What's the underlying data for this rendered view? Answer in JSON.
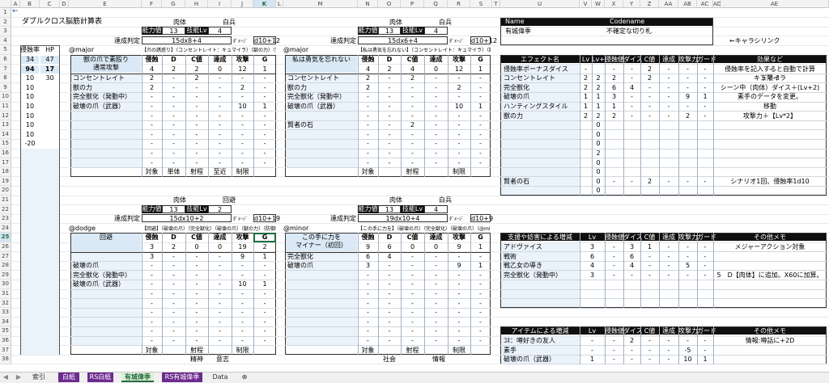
{
  "colors": {
    "tab_purple": "#6d2b8f",
    "tab_green": "#dff0d8",
    "selection_green": "#1e6b3c",
    "header_blue": "#dbe9f6",
    "dark_header": "#0f0f0f"
  },
  "toolbar": {
    "back_arrow": "←"
  },
  "sheet": {
    "title": "ダブルクロス脳筋計算表"
  },
  "columns": [
    "A",
    "B",
    "C",
    "D",
    "E",
    "F",
    "G",
    "H",
    "I",
    "J",
    "K",
    "L",
    "M",
    "N",
    "O",
    "P",
    "Q",
    "R",
    "S",
    "T",
    "U",
    "V",
    "W",
    "X",
    "Y",
    "Z",
    "AA",
    "AB",
    "AC",
    "AD",
    "AE"
  ],
  "rows": [
    "1",
    "2",
    "3",
    "4",
    "5",
    "6",
    "7",
    "8",
    "9",
    "10",
    "11",
    "12",
    "13",
    "14",
    "15",
    "16",
    "17",
    "18",
    "19",
    "20",
    "21",
    "22",
    "23",
    "24",
    "25",
    "26",
    "27",
    "28",
    "29",
    "30",
    "31",
    "32",
    "33",
    "34",
    "35",
    "36",
    "37",
    "38"
  ],
  "left": {
    "h1": "侵蝕率",
    "h2": "HP",
    "vals": [
      [
        "34",
        "47"
      ],
      [
        "94",
        "17"
      ],
      [
        "10",
        "30"
      ],
      [
        "10",
        ""
      ],
      [
        "10",
        ""
      ],
      [
        "10",
        ""
      ],
      [
        "10",
        ""
      ],
      [
        "10",
        ""
      ],
      [
        "10",
        ""
      ],
      [
        "-20",
        ""
      ]
    ]
  },
  "block1": {
    "top_label1": "肉体",
    "top_label2": "白兵",
    "stat_label": "能力値",
    "stat_val": "13",
    "skill_label": "技能Lv",
    "skill_val": "4",
    "judge_label": "達成判定",
    "judge_val": "15dx8+4",
    "dmg_label": "ﾀﾞﾒｰｼﾞ",
    "dmg_val": "d10+12",
    "tag": "@major",
    "caption": "【爪の誘惑り】（コンセントレイト：キュマイラ）（獣の力）（完全獣化）（発動中）",
    "title": "獣の爪で素殴り\n通常攻撃",
    "headers": [
      "侵蝕",
      "D",
      "C値",
      "達成",
      "攻撃",
      "G"
    ],
    "totals": [
      "4",
      "2",
      "2",
      "0",
      "12",
      "1"
    ],
    "rows": [
      {
        "name": "コンセントレイト",
        "v": [
          "2",
          "-",
          "2",
          "-",
          "-",
          "-"
        ]
      },
      {
        "name": "獣の力",
        "v": [
          "2",
          "-",
          "-",
          "-",
          "2",
          "-"
        ]
      },
      {
        "name": "完全獣化（発動中）",
        "v": [
          "-",
          "-",
          "-",
          "-",
          "-",
          "-"
        ]
      },
      {
        "name": "破壊の爪（武器）",
        "v": [
          "-",
          "-",
          "-",
          "-",
          "10",
          "1"
        ]
      },
      {
        "name": "",
        "v": [
          "-",
          "-",
          "-",
          "-",
          "-",
          "-"
        ]
      },
      {
        "name": "",
        "v": [
          "-",
          "-",
          "-",
          "-",
          "-",
          "-"
        ]
      },
      {
        "name": "",
        "v": [
          "-",
          "-",
          "-",
          "-",
          "-",
          "-"
        ]
      },
      {
        "name": "",
        "v": [
          "-",
          "-",
          "-",
          "-",
          "-",
          "-"
        ]
      },
      {
        "name": "",
        "v": [
          "-",
          "-",
          "-",
          "-",
          "-",
          "-"
        ]
      },
      {
        "name": "",
        "v": [
          "-",
          "-",
          "-",
          "-",
          "-",
          "-"
        ]
      }
    ],
    "footer": [
      "対象",
      "単体",
      "射程",
      "至近",
      "制限",
      ""
    ]
  },
  "block2": {
    "top_label1": "肉体",
    "top_label2": "白兵",
    "stat_label": "能力値",
    "stat_val": "13",
    "skill_label": "技能Lv",
    "skill_val": "4",
    "judge_label": "達成判定",
    "judge_val": "15dx6+4",
    "dmg_label": "ﾀﾞﾒｰｼﾞ",
    "dmg_val": "d10+12",
    "tag": "@major",
    "caption": "【私は勇気を忘れない】（コンセントレイト：キュマイラ）（獣の力）（完全獣化）",
    "title": "私は勇気を忘れない",
    "headers": [
      "侵蝕",
      "D",
      "C値",
      "達成",
      "攻撃",
      "G"
    ],
    "totals": [
      "4",
      "2",
      "4",
      "0",
      "12",
      "1"
    ],
    "rows": [
      {
        "name": "コンセントレイト",
        "v": [
          "2",
          "-",
          "2",
          "-",
          "-",
          "-"
        ]
      },
      {
        "name": "獣の力",
        "v": [
          "2",
          "-",
          "-",
          "-",
          "2",
          "-"
        ]
      },
      {
        "name": "完全獣化（発動中）",
        "v": [
          "-",
          "-",
          "-",
          "-",
          "-",
          "-"
        ]
      },
      {
        "name": "破壊の爪（武器）",
        "v": [
          "-",
          "-",
          "-",
          "-",
          "10",
          "1"
        ]
      },
      {
        "name": "",
        "v": [
          "-",
          "-",
          "-",
          "-",
          "-",
          "-"
        ]
      },
      {
        "name": "賢者の石",
        "v": [
          "-",
          "-",
          "2",
          "-",
          "-",
          "-"
        ]
      },
      {
        "name": "",
        "v": [
          "-",
          "-",
          "-",
          "-",
          "-",
          "-"
        ]
      },
      {
        "name": "",
        "v": [
          "-",
          "-",
          "-",
          "-",
          "-",
          "-"
        ]
      },
      {
        "name": "",
        "v": [
          "-",
          "-",
          "-",
          "-",
          "-",
          "-"
        ]
      },
      {
        "name": "",
        "v": [
          "-",
          "-",
          "-",
          "-",
          "-",
          "-"
        ]
      }
    ],
    "footer": [
      "対象",
      "",
      "射程",
      "",
      "制限",
      ""
    ]
  },
  "block3": {
    "top_label1": "肉体",
    "top_label2": "回避",
    "stat_label": "能力値",
    "stat_val": "13",
    "skill_label": "技能Lv",
    "skill_val": "2",
    "judge_label": "達成判定",
    "judge_val": "15dx10+2",
    "dmg_label": "ﾀﾞﾒｰｼﾞ",
    "dmg_val": "d10+19",
    "tag": "@dodge",
    "caption": "【回避】（破壊の爪）（完全獣化）（破壊の爪）（獣の力）（防御ﾎﾞｰﾅｽ）",
    "title": "回避",
    "headers": [
      "侵蝕",
      "D",
      "C値",
      "達成",
      "攻撃",
      "G"
    ],
    "totals": [
      "3",
      "2",
      "0",
      "0",
      "19",
      "2"
    ],
    "rows": [
      {
        "name": "",
        "v": [
          "3",
          "-",
          "-",
          "-",
          "9",
          "1"
        ]
      },
      {
        "name": "破壊の爪",
        "v": [
          "-",
          "-",
          "-",
          "-",
          "-",
          "-"
        ]
      },
      {
        "name": "完全獣化（発動中）",
        "v": [
          "-",
          "-",
          "-",
          "-",
          "-",
          "-"
        ]
      },
      {
        "name": "破壊の爪（武器）",
        "v": [
          "-",
          "-",
          "-",
          "-",
          "10",
          "1"
        ]
      },
      {
        "name": "",
        "v": [
          "-",
          "-",
          "-",
          "-",
          "-",
          "-"
        ]
      },
      {
        "name": "",
        "v": [
          "-",
          "-",
          "-",
          "-",
          "-",
          "-"
        ]
      },
      {
        "name": "",
        "v": [
          "-",
          "-",
          "-",
          "-",
          "-",
          "-"
        ]
      },
      {
        "name": "",
        "v": [
          "-",
          "-",
          "-",
          "-",
          "-",
          "-"
        ]
      },
      {
        "name": "",
        "v": [
          "-",
          "-",
          "-",
          "-",
          "-",
          "-"
        ]
      },
      {
        "name": "",
        "v": [
          "-",
          "-",
          "-",
          "-",
          "-",
          "-"
        ]
      }
    ],
    "footer": [
      "対象",
      "",
      "射程",
      "",
      "制限",
      ""
    ]
  },
  "block4": {
    "top_label1": "肉体",
    "top_label2": "白兵",
    "stat_label": "能力値",
    "stat_val": "13",
    "skill_label": "技能Lv",
    "skill_val": "4",
    "judge_label": "達成判定",
    "judge_val": "19dx10+4",
    "dmg_label": "ﾀﾞﾒｰｼﾞ",
    "dmg_val": "d10+9",
    "tag": "@minor",
    "caption": "【この手に力を】（破壊の爪）（完全獣化）（破壊の爪）（@minor）",
    "title": "この手に力を\nマイナー（初回）",
    "headers": [
      "侵蝕",
      "D",
      "C値",
      "達成",
      "攻撃",
      "G"
    ],
    "totals": [
      "9",
      "6",
      "0",
      "0",
      "9",
      "1"
    ],
    "rows": [
      {
        "name": "完全獣化",
        "v": [
          "6",
          "4",
          "-",
          "-",
          "-",
          "-"
        ]
      },
      {
        "name": "破壊の爪",
        "v": [
          "3",
          "-",
          "-",
          "-",
          "9",
          "1"
        ]
      },
      {
        "name": "",
        "v": [
          "-",
          "-",
          "-",
          "-",
          "-",
          "-"
        ]
      },
      {
        "name": "",
        "v": [
          "-",
          "-",
          "-",
          "-",
          "-",
          "-"
        ]
      },
      {
        "name": "",
        "v": [
          "-",
          "-",
          "-",
          "-",
          "-",
          "-"
        ]
      },
      {
        "name": "",
        "v": [
          "-",
          "-",
          "-",
          "-",
          "-",
          "-"
        ]
      },
      {
        "name": "",
        "v": [
          "-",
          "-",
          "-",
          "-",
          "-",
          "-"
        ]
      },
      {
        "name": "",
        "v": [
          "-",
          "-",
          "-",
          "-",
          "-",
          "-"
        ]
      },
      {
        "name": "",
        "v": [
          "-",
          "-",
          "-",
          "-",
          "-",
          "-"
        ]
      },
      {
        "name": "",
        "v": [
          "-",
          "-",
          "-",
          "-",
          "-",
          "-"
        ]
      }
    ],
    "footer": [
      "対象",
      "",
      "射程",
      "",
      "制限",
      ""
    ]
  },
  "partial": {
    "a": "精神",
    "b": "意志",
    "c": "社会",
    "d": "情報"
  },
  "right": {
    "name_head": "Name",
    "code_head": "Codename",
    "name_val": "有城偉季",
    "code_val": "不確定な切り札",
    "link_note": "←キャラシリンク",
    "eff_headers": [
      "エフェクト名",
      "Lv",
      "Lv+",
      "侵蝕値",
      "ダイス",
      "C値",
      "達成",
      "攻撃力",
      "ガード",
      "効果など"
    ],
    "effects": [
      {
        "name": "侵蝕率ボーナスダイス",
        "v": [
          "-",
          "",
          "-",
          "-",
          "2",
          "-",
          "-",
          "-",
          "-"
        ],
        "note": "侵蝕率を記入すると自動で計算"
      },
      {
        "name": "コンセントレイト",
        "v": [
          "2",
          "2",
          "2",
          "-",
          "2",
          "-",
          "-",
          "-",
          "下限-3"
        ],
        "note": "キュマイラ"
      },
      {
        "name": "完全獣化",
        "v": [
          "2",
          "2",
          "6",
          "4",
          "-",
          "-",
          "-",
          "-",
          ""
        ],
        "note": "シーン中（肉体）ダイス＋(Lv+2)"
      },
      {
        "name": "破壊の爪",
        "v": [
          "1",
          "1",
          "3",
          "-",
          "-",
          "-",
          "9",
          "1",
          ""
        ],
        "note": "素手のデータを変更。"
      },
      {
        "name": "ハンティングスタイル",
        "v": [
          "1",
          "1",
          "1",
          "-",
          "-",
          "-",
          "-",
          "-",
          ""
        ],
        "note": "移動"
      },
      {
        "name": "獣の力",
        "v": [
          "2",
          "2",
          "2",
          "-",
          "-",
          "-",
          "2",
          "-",
          ""
        ],
        "note": "攻撃力＋【Lv*2】"
      },
      {
        "name": "",
        "v": [
          "",
          "0",
          "",
          "",
          "",
          "",
          "",
          "",
          ""
        ],
        "note": ""
      },
      {
        "name": "",
        "v": [
          "",
          "0",
          "",
          "",
          "",
          "",
          "",
          "",
          ""
        ],
        "note": ""
      },
      {
        "name": "",
        "v": [
          "",
          "0",
          "",
          "",
          "",
          "",
          "",
          "",
          ""
        ],
        "note": ""
      },
      {
        "name": "",
        "v": [
          "",
          "2",
          "",
          "",
          "",
          "",
          "",
          "",
          ""
        ],
        "note": ""
      },
      {
        "name": "",
        "v": [
          "",
          "0",
          "",
          "",
          "",
          "",
          "",
          "",
          ""
        ],
        "note": ""
      },
      {
        "name": "",
        "v": [
          "",
          "0",
          "",
          "",
          "",
          "",
          "",
          "",
          ""
        ],
        "note": ""
      },
      {
        "name": "賢者の石",
        "v": [
          "",
          "0",
          "-",
          "-",
          "2",
          "-",
          "-",
          "-",
          ""
        ],
        "note": "シナリオ1回、侵蝕率1d10"
      },
      {
        "name": "",
        "v": [
          "",
          "0",
          "",
          "",
          "",
          "",
          "",
          "",
          ""
        ],
        "note": ""
      }
    ],
    "sup_headers": [
      "支援や妨害による増減",
      "Lv",
      "侵蝕値",
      "ダイス",
      "C値",
      "達成",
      "攻撃力",
      "ガード",
      "その他メモ"
    ],
    "support": [
      {
        "name": "アドヴァイス",
        "v": [
          "3",
          "-",
          "3",
          "1",
          "-",
          "-",
          "-"
        ],
        "note": "メジャーアクション対象"
      },
      {
        "name": "戦術",
        "v": [
          "6",
          "-",
          "6",
          "-",
          "-",
          "-",
          "-"
        ],
        "note": ""
      },
      {
        "name": "戦乙女の導き",
        "v": [
          "4",
          "-",
          "4",
          "-",
          "-",
          "5",
          "-"
        ],
        "note": ""
      },
      {
        "name": "完全獣化（発動中）",
        "v": [
          "3",
          "-",
          "-",
          "-",
          "-",
          "-",
          "-"
        ],
        "note": "5　D【肉体】に追加。X60に加算。"
      },
      {
        "name": "",
        "v": [
          "",
          "",
          "",
          "",
          "",
          "",
          ""
        ],
        "note": ""
      },
      {
        "name": "",
        "v": [
          "",
          "",
          "",
          "",
          "",
          "",
          ""
        ],
        "note": ""
      },
      {
        "name": "",
        "v": [
          "",
          "",
          "",
          "",
          "",
          "",
          ""
        ],
        "note": ""
      }
    ],
    "item_headers": [
      "アイテムによる増減",
      "Lv",
      "侵蝕値",
      "ダイス",
      "C値",
      "達成",
      "攻撃力",
      "ガード",
      "その他メモ"
    ],
    "items": [
      {
        "name": "ｺﾈ：噂好きの友人",
        "v": [
          "-",
          "-",
          "2",
          "-",
          "-",
          "-",
          "-"
        ],
        "note": "情報:噂話に+2D"
      },
      {
        "name": "素手",
        "v": [
          "-",
          "-",
          "-",
          "-",
          "-",
          "-5",
          "-"
        ],
        "note": ""
      },
      {
        "name": "破壊の爪（武器）",
        "v": [
          "1",
          "-",
          "-",
          "-",
          "-",
          "10",
          "1"
        ],
        "note": ""
      }
    ]
  },
  "tabs": [
    {
      "label": "◀",
      "style": "nav"
    },
    {
      "label": "▶",
      "style": "nav"
    },
    {
      "label": "索引",
      "style": "plain"
    },
    {
      "label": "白紙",
      "style": "purple"
    },
    {
      "label": "RS白紙",
      "style": "purple"
    },
    {
      "label": "有城偉季",
      "style": "active"
    },
    {
      "label": "RS有城偉季",
      "style": "purple"
    },
    {
      "label": "Data",
      "style": "plain"
    },
    {
      "label": "⊕",
      "style": "add"
    }
  ]
}
